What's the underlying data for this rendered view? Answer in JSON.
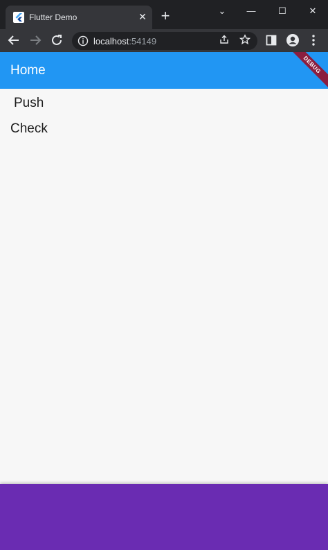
{
  "browser": {
    "tab_title": "Flutter Demo",
    "tab_close_glyph": "✕",
    "new_tab_glyph": "+",
    "url_host": "localhost",
    "url_port": ":54149",
    "window_controls": {
      "chevron": "⌄",
      "minimize": "—",
      "maximize": "☐",
      "close": "✕"
    }
  },
  "app": {
    "appbar_title": "Home",
    "appbar_color": "#2196f3",
    "debug_banner": "DEBUG",
    "items": [
      "Push",
      "Check"
    ],
    "bottom_bar_color": "#6a2cb2"
  },
  "icons": {
    "back": "arrow-left-icon",
    "forward": "arrow-right-icon",
    "reload": "reload-icon",
    "info": "info-icon",
    "share": "share-icon",
    "bookmark": "star-icon",
    "sidepanel": "side-panel-icon",
    "profile": "profile-icon",
    "menu": "kebab-menu-icon"
  }
}
